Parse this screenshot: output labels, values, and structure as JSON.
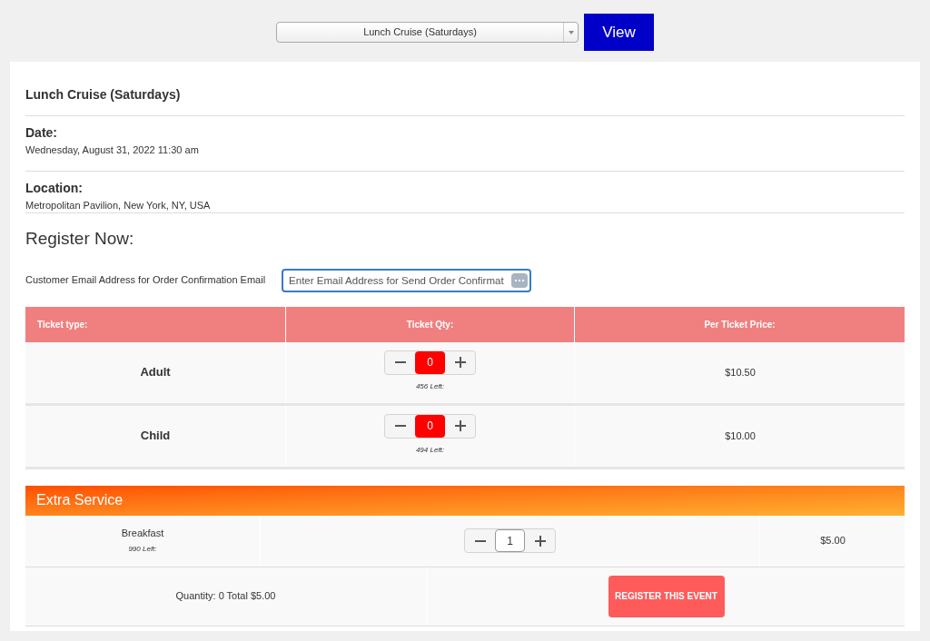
{
  "event_select": {
    "value": "Lunch Cruise (Saturdays)"
  },
  "view_button": "View",
  "event": {
    "title": "Lunch Cruise (Saturdays)",
    "date_label": "Date:",
    "date": "Wednesday, August 31, 2022 11:30 am",
    "location_label": "Location:",
    "location": "Metropolitan Pavilion, New York, NY, USA"
  },
  "register_heading": "Register Now:",
  "email": {
    "label": "Customer Email Address for Order Confirmation Email",
    "placeholder": "Enter Email Address for Send Order Confirmat"
  },
  "ticket_table": {
    "columns": [
      "Ticket type:",
      "Ticket Qty:",
      "Per Ticket Price:"
    ],
    "rows": [
      {
        "type": "Adult",
        "qty": "0",
        "highlight": true,
        "left": "456 Left:",
        "price": "$10.50"
      },
      {
        "type": "Child",
        "qty": "0",
        "highlight": true,
        "left": "494 Left:",
        "price": "$10.00"
      }
    ]
  },
  "extra_service": {
    "title": "Extra Service",
    "rows": [
      {
        "name": "Breakfast",
        "left": "990 Left:",
        "qty": "1",
        "highlight": false,
        "price": "$5.00"
      }
    ]
  },
  "summary": "Quantity: 0 Total $5.00",
  "register_button": "REGISTER THIS EVENT"
}
